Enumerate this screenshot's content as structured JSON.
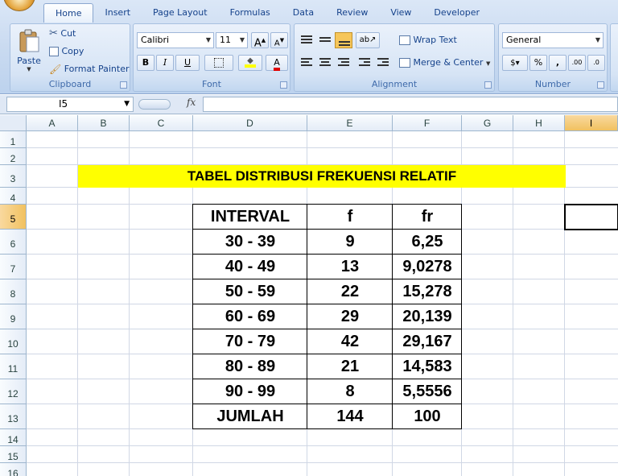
{
  "ribbon": {
    "tabs": [
      "Home",
      "Insert",
      "Page Layout",
      "Formulas",
      "Data",
      "Review",
      "View",
      "Developer"
    ],
    "active_tab": "Home",
    "clipboard": {
      "label": "Clipboard",
      "paste": "Paste",
      "cut": "Cut",
      "copy": "Copy",
      "format_painter": "Format Painter"
    },
    "font": {
      "label": "Font",
      "name": "Calibri",
      "size": "11",
      "bold": "B",
      "italic": "I",
      "underline": "U",
      "grow": "A",
      "shrink": "A",
      "color_letter": "A"
    },
    "alignment": {
      "label": "Alignment",
      "wrap_text": "Wrap Text",
      "merge_center": "Merge & Center"
    },
    "number": {
      "label": "Number",
      "format": "General",
      "percent": "%",
      "comma": ",",
      "inc_decimal": ".00",
      "dec_decimal": ".0"
    }
  },
  "formula_bar": {
    "name_box": "I5",
    "fx": "fx",
    "formula": ""
  },
  "sheet": {
    "columns": [
      "A",
      "B",
      "C",
      "D",
      "E",
      "F",
      "G",
      "H",
      "I"
    ],
    "rows": [
      "1",
      "2",
      "3",
      "4",
      "5",
      "6",
      "7",
      "8",
      "9",
      "10",
      "11",
      "12",
      "13",
      "14",
      "15",
      "16"
    ],
    "selected_column": "I",
    "selected_row": "5",
    "title": "TABEL DISTRIBUSI FREKUENSI RELATIF",
    "table": {
      "headers": [
        "INTERVAL",
        "f",
        "fr"
      ],
      "rows": [
        [
          "30 - 39",
          "9",
          "6,25"
        ],
        [
          "40 - 49",
          "13",
          "9,0278"
        ],
        [
          "50 - 59",
          "22",
          "15,278"
        ],
        [
          "60 - 69",
          "29",
          "20,139"
        ],
        [
          "70 - 79",
          "42",
          "29,167"
        ],
        [
          "80 - 89",
          "21",
          "14,583"
        ],
        [
          "90 - 99",
          "8",
          "5,5556"
        ]
      ],
      "total": [
        "JUMLAH",
        "144",
        "100"
      ]
    }
  },
  "colors": {
    "title_fill": "#ffff00",
    "selection_header": "#f1c15f",
    "ribbon_text": "#15428b"
  }
}
